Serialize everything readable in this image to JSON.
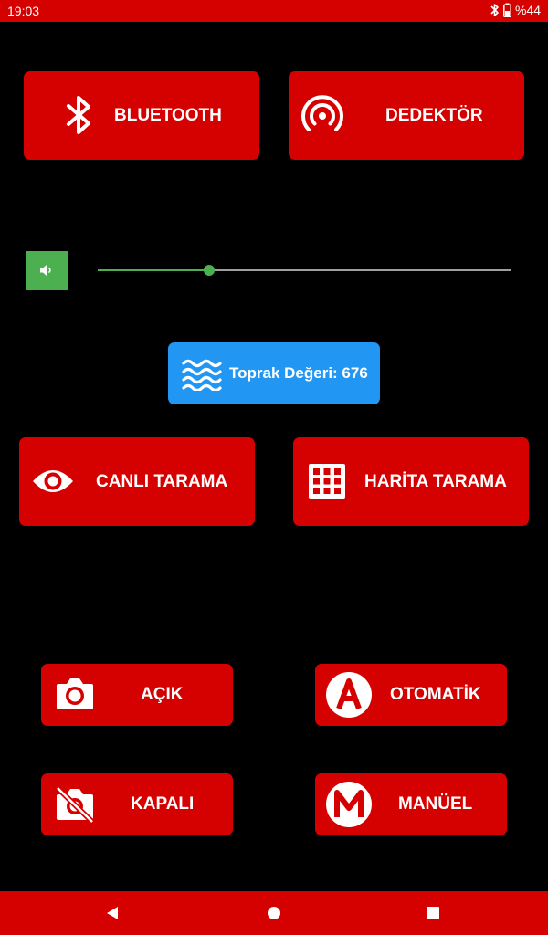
{
  "status_bar": {
    "time": "19:03",
    "battery_text": "%44",
    "icons": [
      "bluetooth-icon",
      "battery-icon"
    ]
  },
  "buttons": {
    "bluetooth": "BLUETOOTH",
    "detector": "DEDEKTÖR",
    "live_scan": "CANLI TARAMA",
    "map_scan": "HARİTA TARAMA",
    "on": "AÇIK",
    "automatic": "OTOMATİK",
    "off": "KAPALI",
    "manual": "MANÜEL"
  },
  "volume": {
    "level": 0.27
  },
  "soil": {
    "label": "Toprak Değeri: 676"
  },
  "colors": {
    "primary_red": "#d50000",
    "green": "#4caf50",
    "blue": "#2196f3",
    "background": "#000000"
  }
}
